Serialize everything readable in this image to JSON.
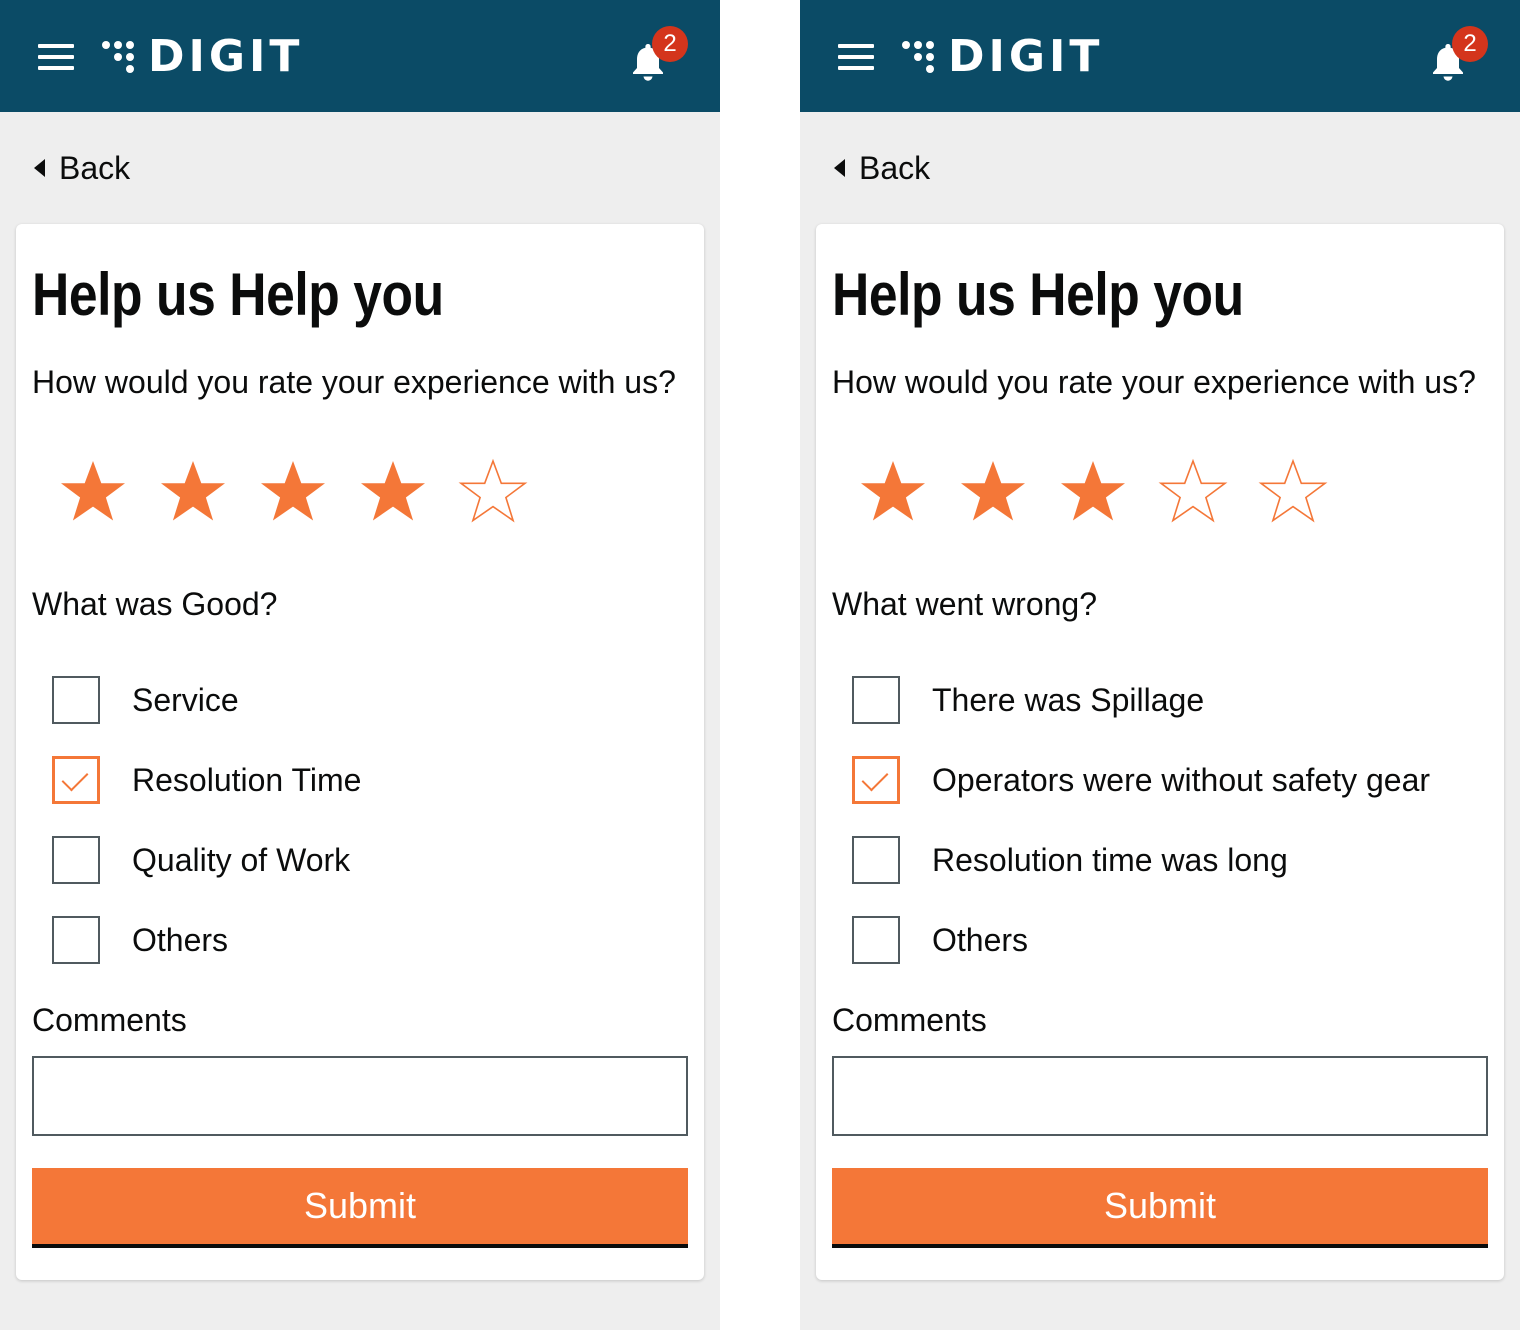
{
  "colors": {
    "header_bg": "#0b4b66",
    "accent": "#f47738",
    "badge": "#d4351c",
    "page_bg": "#eeeeee",
    "text": "#0b0c0c"
  },
  "screens": [
    {
      "header": {
        "logo_text": "DIGIT",
        "menu_icon": "hamburger-icon",
        "notification_icon": "bell-icon",
        "notification_count": "2"
      },
      "back_label": "Back",
      "title": "Help us Help you",
      "question": "How would you rate your experience with us?",
      "rating": {
        "value": 4,
        "max": 5
      },
      "section_label": "What was Good?",
      "options": [
        {
          "label": "Service",
          "checked": false
        },
        {
          "label": "Resolution Time",
          "checked": true
        },
        {
          "label": "Quality of Work",
          "checked": false
        },
        {
          "label": "Others",
          "checked": false
        }
      ],
      "comments_label": "Comments",
      "comments_value": "",
      "submit_label": "Submit"
    },
    {
      "header": {
        "logo_text": "DIGIT",
        "menu_icon": "hamburger-icon",
        "notification_icon": "bell-icon",
        "notification_count": "2"
      },
      "back_label": "Back",
      "title": "Help us Help you",
      "question": "How would you rate your experience with us?",
      "rating": {
        "value": 3,
        "max": 5
      },
      "section_label": "What went wrong?",
      "options": [
        {
          "label": "There was Spillage",
          "checked": false
        },
        {
          "label": "Operators were without safety gear",
          "checked": true
        },
        {
          "label": "Resolution time was long",
          "checked": false
        },
        {
          "label": "Others",
          "checked": false
        }
      ],
      "comments_label": "Comments",
      "comments_value": "",
      "submit_label": "Submit"
    }
  ]
}
